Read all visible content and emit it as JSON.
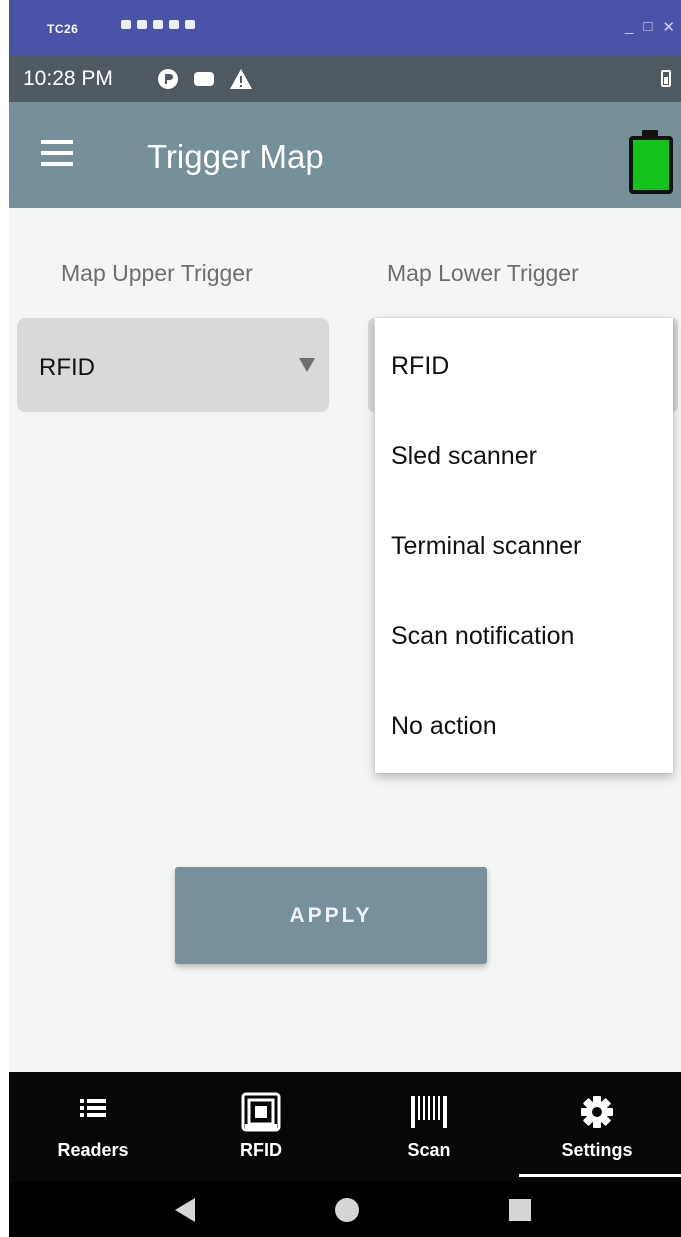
{
  "window": {
    "title": "TC26",
    "controls": {
      "minimize": "_",
      "maximize": "□",
      "close": "✕"
    }
  },
  "statusbar": {
    "time": "10:28 PM"
  },
  "appbar": {
    "title": "Trigger Map"
  },
  "content": {
    "upper_label": "Map Upper Trigger",
    "lower_label": "Map Lower Trigger",
    "upper_value": "RFID",
    "dropdown_options": [
      "RFID",
      "Sled scanner",
      "Terminal scanner",
      "Scan notification",
      "No action"
    ],
    "apply_label": "APPLY"
  },
  "bottomnav": {
    "items": [
      {
        "label": "Readers",
        "icon": "list-icon"
      },
      {
        "label": "RFID",
        "icon": "rfid-icon"
      },
      {
        "label": "Scan",
        "icon": "barcode-icon"
      },
      {
        "label": "Settings",
        "icon": "gear-icon"
      }
    ],
    "active": "Settings"
  },
  "colors": {
    "appbar": "#76909a",
    "statusbar": "#4e5961",
    "windowbar": "#4a53a8",
    "apply_button": "#77909b",
    "battery_fill": "#13c21a"
  }
}
